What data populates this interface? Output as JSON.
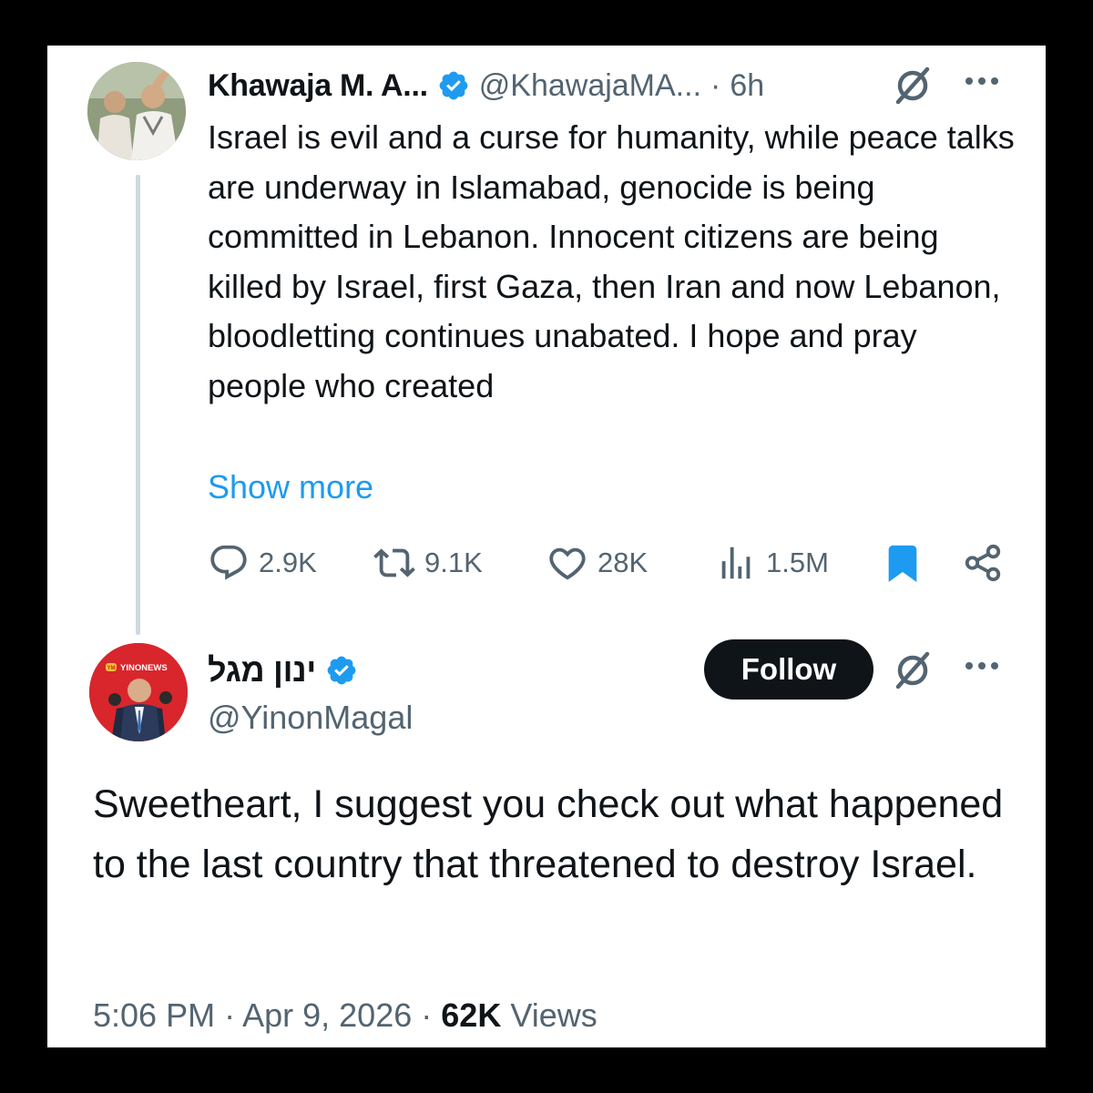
{
  "quoted_tweet": {
    "author_name": "Khawaja M. A...",
    "handle": "@KhawajaMA...",
    "separator": "·",
    "time_ago": "6h",
    "text": "Israel is evil and a curse for humanity, while peace talks are underway in Islamabad, genocide is being committed in Lebanon. Innocent citizens are being killed by Israel, first Gaza, then Iran and now Lebanon, bloodletting continues unabated. I hope and pray people who created",
    "show_more": "Show more",
    "actions": {
      "replies": "2.9K",
      "reposts": "9.1K",
      "likes": "28K",
      "views": "1.5M"
    },
    "verified": true
  },
  "main_tweet": {
    "author_name": "ינון מגל",
    "handle": "@YinonMagal",
    "avatar_label": "YINONEWS",
    "avatar_logo": "YM",
    "follow_label": "Follow",
    "text": "Sweetheart, I suggest you check out what happened to the last country that threatened to destroy Israel.",
    "time": "5:06 PM",
    "date": "Apr 9, 2026",
    "views_count": "62K",
    "views_label": "Views",
    "separator": "·",
    "verified": true
  },
  "colors": {
    "text": "#0f1419",
    "secondary": "#536471",
    "link": "#1d9bf0",
    "verified_badge": "#1d9bf0",
    "bookmark": "#1d9bf0",
    "follow_bg": "#0f1419",
    "thread_line": "#cfd9de",
    "avatar2_bg": "#d8262c"
  },
  "icons": [
    "verified-badge-icon",
    "grok-icon",
    "more-icon",
    "reply-icon",
    "repost-icon",
    "like-icon",
    "views-icon",
    "bookmark-icon",
    "share-icon"
  ]
}
